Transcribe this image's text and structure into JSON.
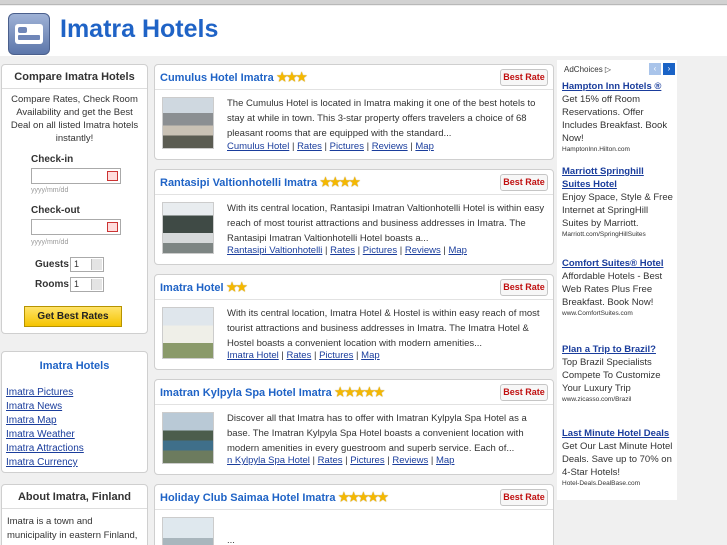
{
  "header": {
    "title": "Imatra Hotels"
  },
  "compare": {
    "heading": "Compare Imatra Hotels",
    "description": "Compare Rates, Check Room Availability and get the Best Deal on all listed Imatra hotels instantly!",
    "checkin_label": "Check-in",
    "checkin_hint": "yyyy/mm/dd",
    "checkout_label": "Check-out",
    "checkout_hint": "yyyy/mm/dd",
    "guests_label": "Guests",
    "guests_value": "1",
    "rooms_label": "Rooms",
    "rooms_value": "1",
    "button_label": "Get Best Rates"
  },
  "imatra_links": {
    "heading": "Imatra Hotels",
    "items": [
      "Imatra Pictures",
      "Imatra News",
      "Imatra Map",
      "Imatra Weather",
      "Imatra Attractions",
      "Imatra Currency"
    ]
  },
  "about": {
    "heading": "About Imatra, Finland",
    "text": "Imatra is a town and municipality in eastern Finland, founded in"
  },
  "hotels": [
    {
      "name": "Cumulus Hotel Imatra",
      "stars": 3,
      "best_rate": "Best Rate",
      "description": "The Cumulus Hotel is located in Imatra making it one of the best hotels to stay at while in town. This 3-star property offers travelers a choice of 68 pleasant rooms that are equipped with the standard...",
      "links": [
        "Cumulus Hotel",
        "Rates",
        "Pictures",
        "Reviews",
        "Map"
      ]
    },
    {
      "name": "Rantasipi Valtionhotelli Imatra",
      "stars": 4,
      "best_rate": "Best Rate",
      "description": "With its central location, Rantasipi Imatran Valtionhotelli Hotel is within easy reach of most tourist attractions and business addresses in Imatra. The Rantasipi Imatran Valtionhotelli Hotel boasts a...",
      "links": [
        "Rantasipi Valtionhotelli",
        "Rates",
        "Pictures",
        "Reviews",
        "Map"
      ]
    },
    {
      "name": "Imatra Hotel",
      "stars": 2,
      "best_rate": "Best Rate",
      "description": "With its central location, Imatra Hotel & Hostel is within easy reach of most tourist attractions and business addresses in Imatra. The Imatra Hotel & Hostel boasts a convenient location with modern amenities...",
      "links": [
        "Imatra Hotel",
        "Rates",
        "Pictures",
        "Map"
      ]
    },
    {
      "name": "Imatran Kylpyla Spa Hotel Imatra",
      "stars": 5,
      "best_rate": "Best Rate",
      "description": "Discover all that Imatra has to offer with Imatran Kylpyla Spa Hotel as a base. The Imatran Kylpyla Spa Hotel boasts a convenient location with modern amenities in every guestroom and superb service. Each of...",
      "links": [
        "n Kylpyla Spa Hotel",
        "Rates",
        "Pictures",
        "Reviews",
        "Map"
      ]
    },
    {
      "name": "Holiday Club Saimaa Hotel Imatra",
      "stars": 5,
      "best_rate": "Best Rate",
      "description": "...",
      "links": []
    }
  ],
  "ads": {
    "adchoices_label": "AdChoices ▷",
    "items": [
      {
        "title": "Hampton Inn Hotels ®",
        "body": "Get 15% off Room Reservations. Offer Includes Breakfast. Book Now!",
        "url": "HamptonInn.Hilton.com"
      },
      {
        "title": "Marriott Springhill Suites Hotel",
        "body": "Enjoy Space, Style & Free Internet at SpringHill Suites by Marriott.",
        "url": "Marriott.com/SpringHillSuites"
      },
      {
        "title": "Comfort Suites® Hotel",
        "body": "Affordable Hotels - Best Web Rates Plus Free Breakfast. Book Now!",
        "url": "www.ComfortSuites.com"
      },
      {
        "title": "Plan a Trip to Brazil?",
        "body": "Top Brazil Specialists Compete To Customize Your Luxury Trip",
        "url": "www.zicasso.com/Brazil"
      },
      {
        "title": "Last Minute Hotel Deals",
        "body": "Get Our Last Minute Hotel Deals. Save up to 70% on 4-Star Hotels!",
        "url": "Hotel-Deals.DealBase.com"
      }
    ]
  },
  "colors": {
    "accent": "#1f63c6",
    "link": "#1a3d9c",
    "star": "#f5b800",
    "best_rate": "#c01010",
    "button": "#f5c400"
  }
}
